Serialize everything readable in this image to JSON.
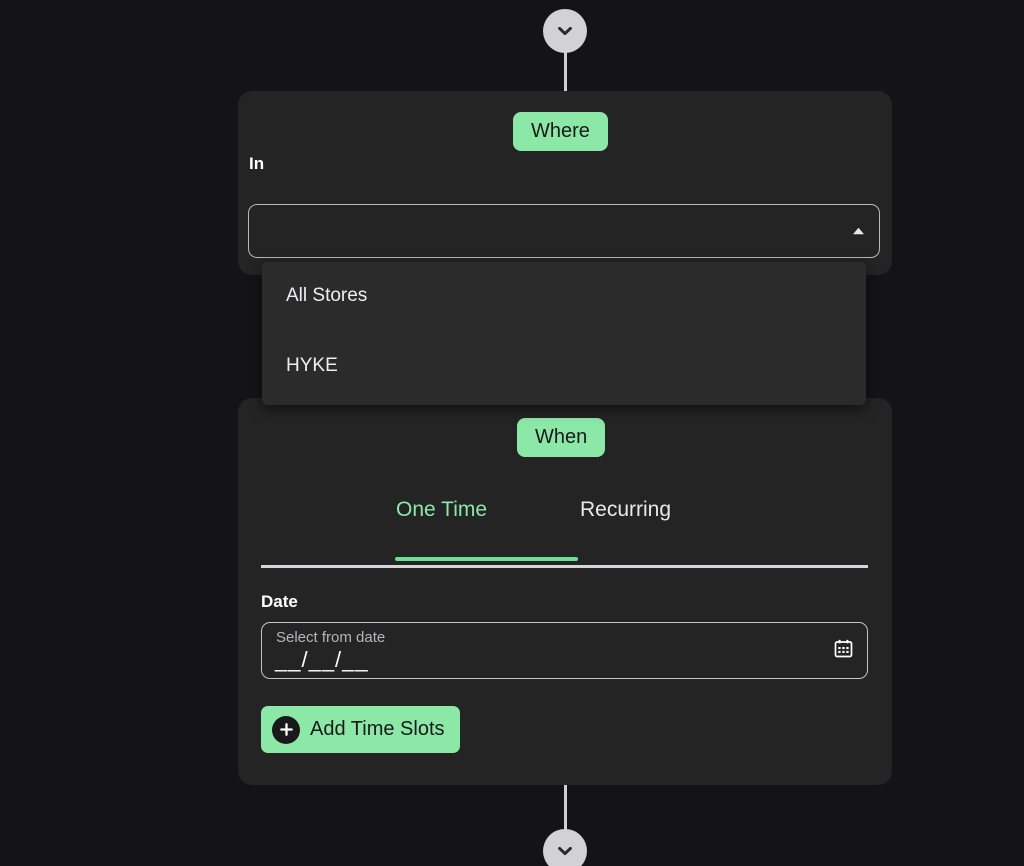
{
  "theme": {
    "background": "#141416",
    "card_background": "#242425",
    "dropdown_background": "#2b2b2c",
    "accent_green": "#8ce8a7",
    "underline_green": "#6ddf92",
    "text_primary": "#ffffff",
    "text_muted": "#b6b6ba",
    "on_accent_text": "#19191b",
    "connector": "#d2d2d6"
  },
  "flow": {
    "top_node_icon": "chevron-down-icon",
    "bottom_node_icon": "chevron-down-icon"
  },
  "where": {
    "badge_label": "Where",
    "field_label": "In",
    "select": {
      "value": "",
      "placeholder": "",
      "caret_icon": "chevron-up-icon",
      "expanded": true
    },
    "dropdown_options": [
      {
        "label": "All Stores"
      },
      {
        "label": "HYKE"
      }
    ]
  },
  "when": {
    "badge_label": "When",
    "tabs": [
      {
        "label": "One Time",
        "active": true
      },
      {
        "label": "Recurring",
        "active": false
      }
    ],
    "date": {
      "label": "Date",
      "caption": "Select from date",
      "value": "__/__/__",
      "icon": "calendar-icon"
    },
    "add_time_slots": {
      "label": "Add Time Slots",
      "icon": "plus-circle-icon"
    }
  }
}
